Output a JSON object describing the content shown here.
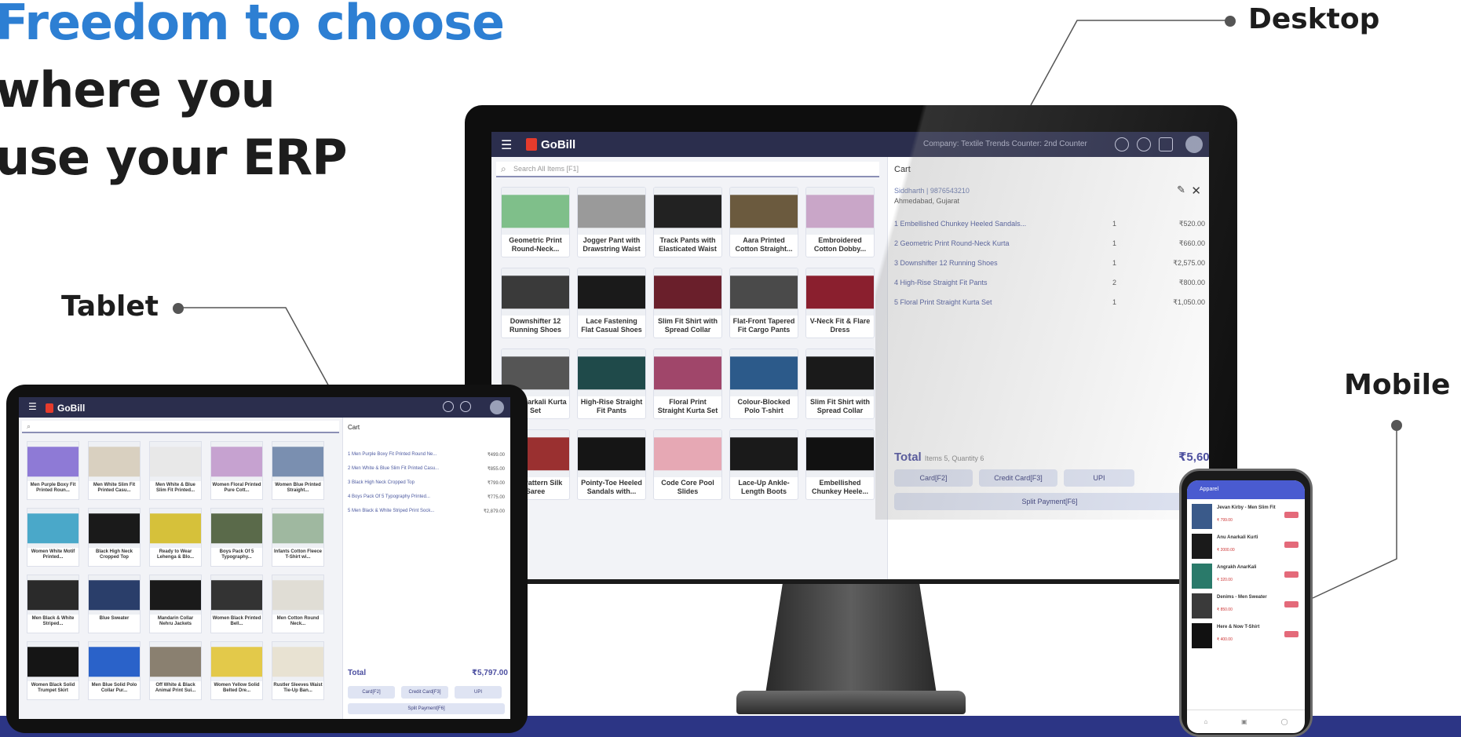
{
  "headline": {
    "line1": "Freedom to choose",
    "line2": "where you",
    "line3": "use your ERP"
  },
  "callouts": {
    "desktop": "Desktop",
    "tablet": "Tablet",
    "mobile": "Mobile"
  },
  "colors": {
    "accent_blue": "#2d7fd3",
    "appbar": "#2b2e4d",
    "band": "#2c3585",
    "logo_mark": "#e53b2c"
  },
  "desktop": {
    "app_name": "GoBill",
    "company_info": "Company: Textile Trends  Counter: 2nd Counter",
    "search_placeholder": "Search All Items [F1]",
    "products": [
      {
        "name": "Geometric Print Round-Neck...",
        "color": "#7fbf8a"
      },
      {
        "name": "Jogger Pant with Drawstring Waist",
        "color": "#9a9a9a"
      },
      {
        "name": "Track Pants with Elasticated Waist",
        "color": "#222222"
      },
      {
        "name": "Aara Printed Cotton Straight...",
        "color": "#6b5a3e"
      },
      {
        "name": "Embroidered Cotton Dobby...",
        "color": "#c9a6c8"
      },
      {
        "name": "Downshifter 12 Running Shoes",
        "color": "#3a3a3a"
      },
      {
        "name": "Lace Fastening Flat Casual Shoes",
        "color": "#1a1a1a"
      },
      {
        "name": "Slim Fit Shirt with Spread Collar",
        "color": "#6a1f2b"
      },
      {
        "name": "Flat-Front Tapered Fit Cargo Pants",
        "color": "#4a4a4a"
      },
      {
        "name": "V-Neck Fit & Flare Dress",
        "color": "#8a1f2e"
      },
      {
        "name": "Jan Anarkali Kurta Set",
        "color": "#555555"
      },
      {
        "name": "High-Rise Straight Fit Pants",
        "color": "#1f4a4a"
      },
      {
        "name": "Floral Print Straight Kurta Set",
        "color": "#a0466a"
      },
      {
        "name": "Colour-Blocked Polo T-shirt",
        "color": "#2c5a8a"
      },
      {
        "name": "Slim Fit Shirt with Spread Collar",
        "color": "#1a1a1a"
      },
      {
        "name": "oral Pattern Silk Saree",
        "color": "#9a3030"
      },
      {
        "name": "Pointy-Toe Heeled Sandals with...",
        "color": "#151515"
      },
      {
        "name": "Code Core Pool Slides",
        "color": "#e6a8b4"
      },
      {
        "name": "Lace-Up Ankle-Length Boots",
        "color": "#1a1a1a"
      },
      {
        "name": "Embellished Chunkey Heele...",
        "color": "#111111"
      }
    ],
    "cart": {
      "title": "Cart",
      "customer": "Siddharth | 9876543210",
      "city": "Ahmedabad, Gujarat",
      "lines": [
        {
          "item": "1  Embellished Chunkey Heeled Sandals...",
          "qty": "1",
          "price": "₹520.00"
        },
        {
          "item": "2  Geometric Print Round-Neck Kurta",
          "qty": "1",
          "price": "₹660.00"
        },
        {
          "item": "3  Downshifter 12 Running Shoes",
          "qty": "1",
          "price": "₹2,575.00"
        },
        {
          "item": "4  High-Rise Straight Fit Pants",
          "qty": "2",
          "price": "₹800.00"
        },
        {
          "item": "5  Floral Print Straight Kurta Set",
          "qty": "1",
          "price": "₹1,050.00"
        }
      ],
      "total_label": "Total",
      "total_meta": "Items 5, Quantity 6",
      "total_amount": "₹5,60",
      "btn_card": "Card[F2]",
      "btn_credit": "Credit Card[F3]",
      "btn_upi": "UPI",
      "btn_split": "Split Payment[F6]"
    }
  },
  "tablet": {
    "app_name": "GoBill",
    "products": [
      {
        "name": "Men Purple Boxy Fit Printed Roun...",
        "color": "#8e7ad6"
      },
      {
        "name": "Men White Slim Fit Printed Casu...",
        "color": "#d9d0c0"
      },
      {
        "name": "Men White & Blue Slim Fit Printed...",
        "color": "#e8e8e8"
      },
      {
        "name": "Women Floral Printed Pure Cott...",
        "color": "#c6a2d0"
      },
      {
        "name": "Women Blue Printed Straight...",
        "color": "#7a8fb0"
      },
      {
        "name": "Women White Motif Printed...",
        "color": "#4aa8c9"
      },
      {
        "name": "Black High Neck Cropped Top",
        "color": "#1a1a1a"
      },
      {
        "name": "Ready to Wear Lehenga & Blo...",
        "color": "#d6c13a"
      },
      {
        "name": "Boys Pack Of 5 Typography...",
        "color": "#5a6a4a"
      },
      {
        "name": "Infants Cotton Fleece T-Shirt wi...",
        "color": "#9fb8a0"
      },
      {
        "name": "Men Black & White Striped...",
        "color": "#2a2a2a"
      },
      {
        "name": "Blue Sweater",
        "color": "#2a3e6a"
      },
      {
        "name": "Mandarin Collar Nehru Jackets",
        "color": "#1a1a1a"
      },
      {
        "name": "Women Black Printed Bell...",
        "color": "#333333"
      },
      {
        "name": "Men Cotton Round Neck...",
        "color": "#e0ddd5"
      },
      {
        "name": "Women Black Solid Trumpet Skirt",
        "color": "#151515"
      },
      {
        "name": "Men Blue Solid Polo Collar Pur...",
        "color": "#2a62c9"
      },
      {
        "name": "Off White & Black Animal Print Sui...",
        "color": "#8a8070"
      },
      {
        "name": "Women Yellow Solid Belted Dre...",
        "color": "#e3c94a"
      },
      {
        "name": "Rustler Sleeves Waist Tie-Up Ban...",
        "color": "#e8e2d2"
      }
    ],
    "cart": {
      "title": "Cart",
      "lines": [
        {
          "item": "1  Men Purple Boxy Fit Printed Round Ne...",
          "price": "₹499.00"
        },
        {
          "item": "2  Men White & Blue Slim Fit Printed Casu...",
          "price": "₹855.00"
        },
        {
          "item": "3  Black High Neck Cropped Top",
          "price": "₹799.00"
        },
        {
          "item": "4  Boys Pack Of 5 Typography Printed...",
          "price": "₹775.00"
        },
        {
          "item": "5  Men Black & White Striped Print Sock...",
          "price": "₹2,879.00"
        }
      ],
      "total_label": "Total",
      "total_amount": "₹5,797.00",
      "btn_card": "Card[F2]",
      "btn_credit": "Credit Card[F3]",
      "btn_upi": "UPI",
      "btn_split": "Split Payment[F6]"
    }
  },
  "mobile": {
    "header": "Apparel",
    "items": [
      {
        "title": "Jevan Kirby - Men Slim Fit",
        "price": "₹ 799.00",
        "color": "#3a5a8a"
      },
      {
        "title": "Anu  Anarkali Kurti",
        "price": "₹ 2000.00",
        "color": "#1a1a1a"
      },
      {
        "title": "Angrakh  AnarKali",
        "price": "₹ 320.00",
        "color": "#2a7a6a"
      },
      {
        "title": "Denims - Men Sweater",
        "price": "₹ 850.00",
        "color": "#3a3a3a"
      },
      {
        "title": "Here & Now T-Shirt",
        "price": "₹ 400.00",
        "color": "#111111"
      }
    ]
  }
}
